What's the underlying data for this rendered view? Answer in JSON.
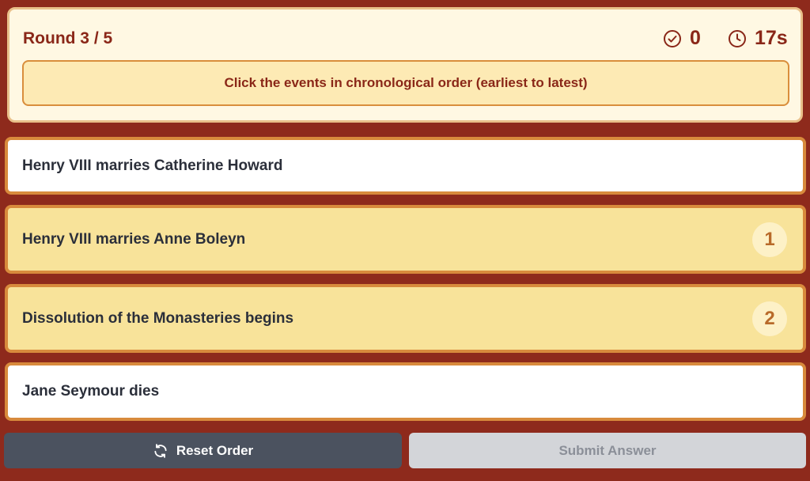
{
  "header": {
    "round_label": "Round 3 / 5",
    "score": "0",
    "score_icon": "check-circle-icon",
    "timer": "17s",
    "timer_icon": "clock-icon",
    "instruction": "Click the events in chronological order (earliest to latest)"
  },
  "events": [
    {
      "label": "Henry VIII marries Catherine Howard",
      "selected": false,
      "order": ""
    },
    {
      "label": "Henry VIII marries Anne Boleyn",
      "selected": true,
      "order": "1"
    },
    {
      "label": "Dissolution of the Monasteries begins",
      "selected": true,
      "order": "2"
    },
    {
      "label": "Jane Seymour dies",
      "selected": false,
      "order": ""
    }
  ],
  "buttons": {
    "reset_label": "Reset Order",
    "reset_icon": "refresh-icon",
    "submit_label": "Submit Answer",
    "submit_disabled": true
  },
  "colors": {
    "background": "#8e2a1c",
    "accent_text": "#8a2718",
    "selected_card": "#f8e39a",
    "card_border": "#d88a3c"
  }
}
